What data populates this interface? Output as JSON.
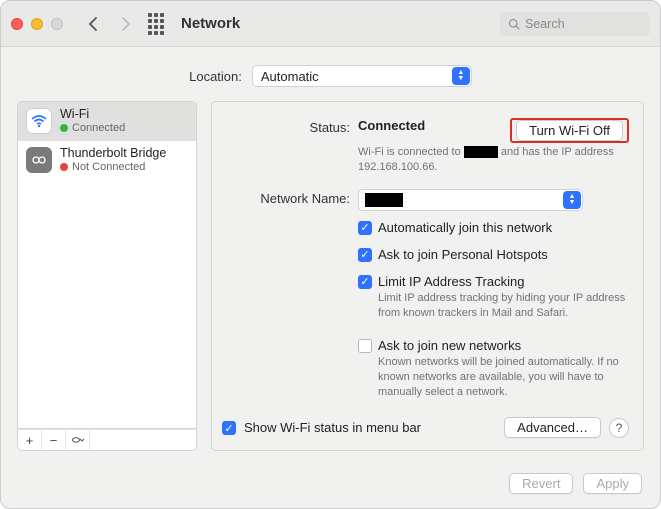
{
  "window": {
    "title": "Network"
  },
  "search": {
    "placeholder": "Search"
  },
  "location": {
    "label": "Location:",
    "selected": "Automatic"
  },
  "sidebar": {
    "items": [
      {
        "name": "Wi-Fi",
        "status": "Connected"
      },
      {
        "name": "Thunderbolt Bridge",
        "status": "Not Connected"
      }
    ]
  },
  "status": {
    "label": "Status:",
    "value": "Connected",
    "toggle_button": "Turn Wi-Fi Off",
    "detail_prefix": "Wi-Fi is connected to",
    "detail_suffix": "and has the IP address 192.168.100.66."
  },
  "network_name": {
    "label": "Network Name:"
  },
  "checkboxes": {
    "auto_join": "Automatically join this network",
    "personal_hotspots": "Ask to join Personal Hotspots",
    "limit_ip": "Limit IP Address Tracking",
    "limit_ip_desc": "Limit IP address tracking by hiding your IP address from known trackers in Mail and Safari.",
    "ask_new": "Ask to join new networks",
    "ask_new_desc": "Known networks will be joined automatically. If no known networks are available, you will have to manually select a network."
  },
  "menubar": {
    "show_status": "Show Wi-Fi status in menu bar"
  },
  "buttons": {
    "advanced": "Advanced…",
    "revert": "Revert",
    "apply": "Apply",
    "help": "?"
  }
}
